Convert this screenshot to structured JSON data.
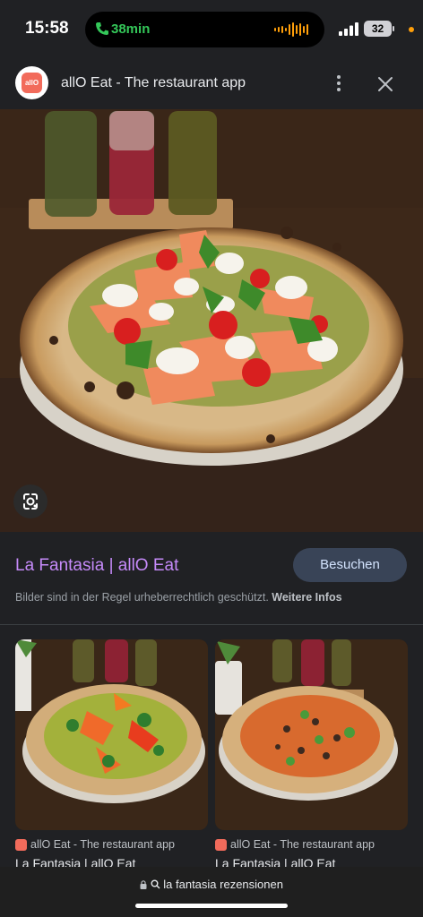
{
  "status_bar": {
    "time": "15:58",
    "call_duration": "38min",
    "battery": "32"
  },
  "header": {
    "logo_text": "allO",
    "title": "allO Eat - The restaurant app"
  },
  "result": {
    "title": "La Fantasia | allO Eat",
    "visit_label": "Besuchen",
    "copyright_text": "Bilder sind in der Regel urheberrechtlich geschützt.",
    "more_info": "Weitere Infos"
  },
  "related": [
    {
      "source": "allO Eat - The restaurant app",
      "title": "La Fantasia | allO Eat"
    },
    {
      "source": "allO Eat - The restaurant app",
      "title": "La Fantasia | allO Eat"
    }
  ],
  "bottom_bar": {
    "url": "la fantasia rezensionen"
  },
  "colors": {
    "background": "#202124",
    "title_link": "#c58af9",
    "visit_button": "#394457",
    "brand": "#f26b5b"
  }
}
